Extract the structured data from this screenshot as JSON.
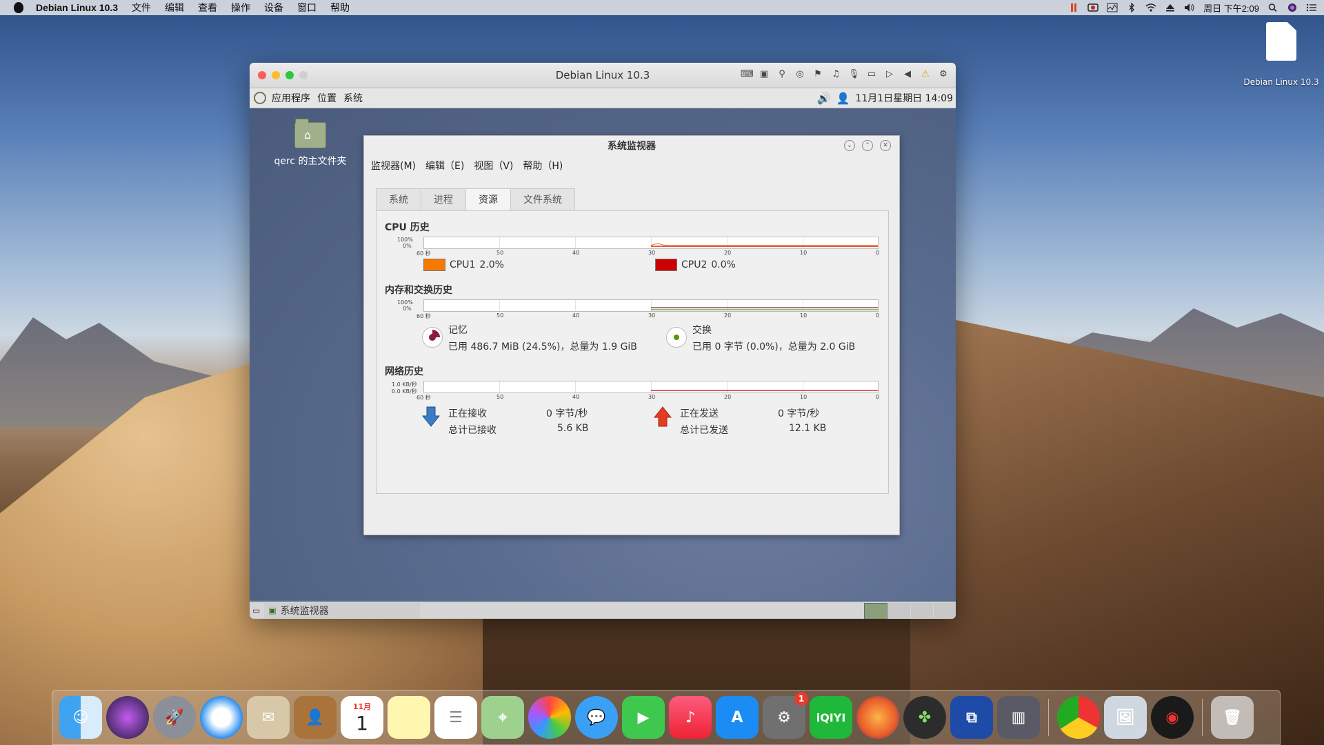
{
  "mac_menubar": {
    "app_name": "Debian Linux 10.3",
    "menus": [
      "文件",
      "编辑",
      "查看",
      "操作",
      "设备",
      "窗口",
      "帮助"
    ],
    "clock": "周日 下午2:09"
  },
  "desktop_file": {
    "label": "Debian Linux 10.3"
  },
  "vm_window": {
    "title": "Debian Linux 10.3"
  },
  "debian_panel": {
    "menus": [
      "应用程序",
      "位置",
      "系统"
    ],
    "datetime": "11月1日星期日 14:09"
  },
  "debian_desktop": {
    "home_folder_label": "qerc 的主文件夹"
  },
  "sysmon": {
    "title": "系统监视器",
    "menus": [
      "监视器(M)",
      "编辑（E)",
      "视图（V)",
      "帮助（H)"
    ],
    "tabs": [
      "系统",
      "进程",
      "资源",
      "文件系统"
    ],
    "active_tab": "资源",
    "cpu": {
      "title": "CPU 历史",
      "y_top": "100%",
      "y_bottom": "0%",
      "x_ticks": [
        "60 秒",
        "50",
        "40",
        "30",
        "20",
        "10",
        "0"
      ],
      "cpu1_label": "CPU1",
      "cpu1_value": "2.0%",
      "cpu1_color": "#f57900",
      "cpu2_label": "CPU2",
      "cpu2_value": "0.0%",
      "cpu2_color": "#cc0000"
    },
    "memory": {
      "title": "内存和交换历史",
      "y_top": "100%",
      "y_bottom": "0%",
      "x_ticks": [
        "60 秒",
        "50",
        "40",
        "30",
        "20",
        "10",
        "0"
      ],
      "mem_label": "记忆",
      "mem_detail": "已用 486.7 MiB (24.5%)，总量为 1.9 GiB",
      "mem_color": "#8b1a4a",
      "swap_label": "交换",
      "swap_detail": "已用 0 字节 (0.0%)，总量为 2.0 GiB",
      "swap_color": "#4e9a06"
    },
    "network": {
      "title": "网络历史",
      "y_top": "1.0 KB/秒",
      "y_bottom": "0.0 KB/秒",
      "x_ticks": [
        "60 秒",
        "50",
        "40",
        "30",
        "20",
        "10",
        "0"
      ],
      "recv_label": "正在接收",
      "recv_rate": "0 字节/秒",
      "recv_total_label": "总计已接收",
      "recv_total": "5.6 KB",
      "send_label": "正在发送",
      "send_rate": "0 字节/秒",
      "send_total_label": "总计已发送",
      "send_total": "12.1 KB"
    }
  },
  "taskbar": {
    "task_label": "系统监视器"
  },
  "dock": {
    "calendar_month": "11月",
    "calendar_day": "1",
    "iqiyi_label": "iQIYI",
    "settings_badge": "1"
  }
}
